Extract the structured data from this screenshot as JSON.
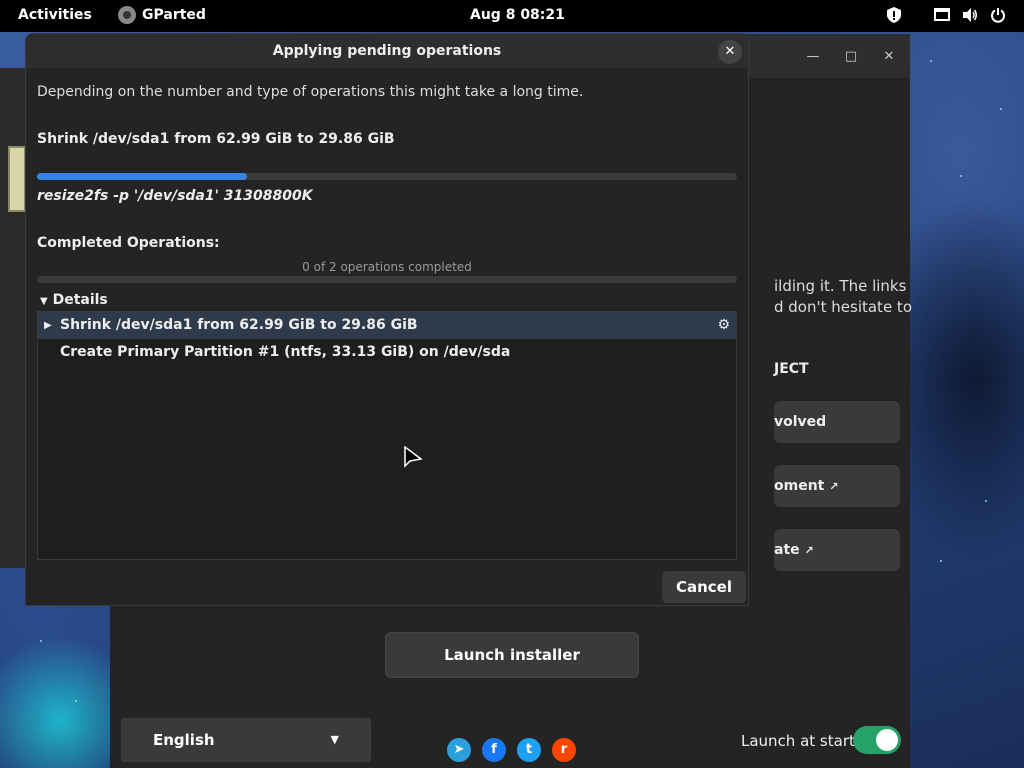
{
  "topbar": {
    "activities": "Activities",
    "app_name": "GParted",
    "clock": "Aug 8  08:21",
    "icons": [
      "shield-icon",
      "screen-icon",
      "volume-icon",
      "power-icon"
    ]
  },
  "dialog": {
    "title": "Applying pending operations",
    "description": "Depending on the number and type of operations this might take a long time.",
    "current_operation": "Shrink /dev/sda1 from 62.99 GiB to 29.86 GiB",
    "current_progress": 0.3,
    "command": "resize2fs -p '/dev/sda1' 31308800K",
    "completed_label": "Completed Operations:",
    "completed_count": "0 of 2 operations completed",
    "details_label": "Details",
    "operations": [
      {
        "label": "Shrink /dev/sda1 from 62.99 GiB to 29.86 GiB"
      },
      {
        "label": "Create Primary Partition #1 (ntfs, 33.13 GiB) on /dev/sda"
      }
    ],
    "cancel_label": "Cancel"
  },
  "welcome": {
    "text_line1": "ilding it. The links",
    "text_line2": "d don't hesitate to",
    "section_heading": "JECT",
    "cards": [
      "volved",
      "oment",
      "ate"
    ],
    "launch_installer": "Launch installer",
    "language": "English",
    "launch_at_start": "Launch at start",
    "launch_at_start_enabled": true
  },
  "colors": {
    "accent": "#3584e4",
    "toggle_on": "#26a269"
  }
}
